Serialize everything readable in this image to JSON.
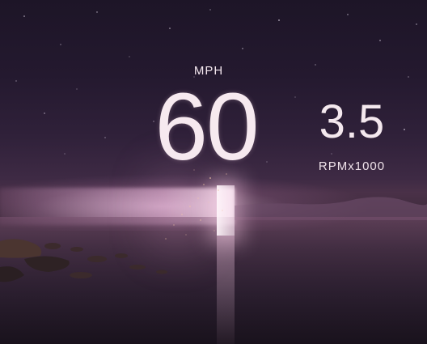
{
  "speedometer": {
    "unit": "MPH",
    "value": "60"
  },
  "tachometer": {
    "value": "3.5",
    "unit": "RPMx1000"
  },
  "colors": {
    "text": "#f4e8ee",
    "sky_top": "#1d1527",
    "horizon_glow": "#f0c8e6"
  }
}
